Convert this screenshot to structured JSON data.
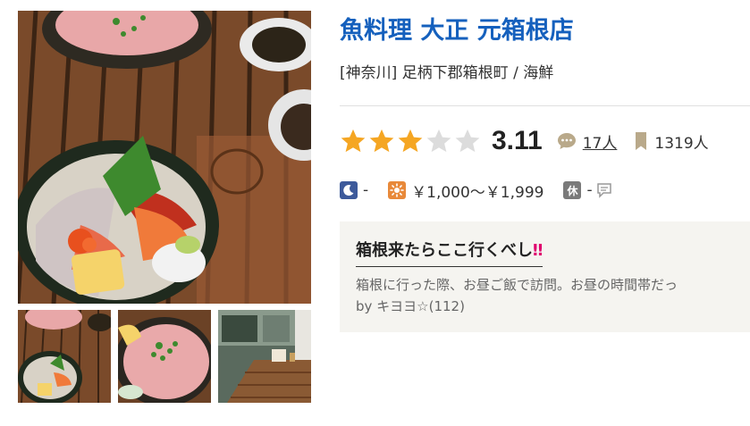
{
  "restaurant": {
    "name": "魚料理 大正 元箱根店",
    "area": "[神奈川] 足柄下郡箱根町 / 海鮮"
  },
  "rating": {
    "stars_filled": 3,
    "stars_total": 5,
    "score": "3.11",
    "review_count": "17人",
    "bookmark_count": "1319人"
  },
  "budget": {
    "dinner": "-",
    "lunch": "￥1,000～￥1,999",
    "holiday_label": "休",
    "holiday": "-"
  },
  "review": {
    "title": "箱根来たらここ行くべし",
    "title_emphasis": "‼",
    "excerpt": "箱根に行った際、お昼ご飯で訪問。お昼の時間帯だっ",
    "author": "by キヨヨ☆(112)"
  },
  "icons": {
    "dinner": "moon-icon",
    "lunch": "sun-icon",
    "reviews": "speech-bubble-icon",
    "bookmarks": "bookmark-icon",
    "holiday_note": "memo-icon"
  },
  "colors": {
    "title": "#1560bd",
    "star_filled": "#f5a623",
    "star_empty": "#dcdcdc",
    "review_bg": "#f5f4f0"
  }
}
